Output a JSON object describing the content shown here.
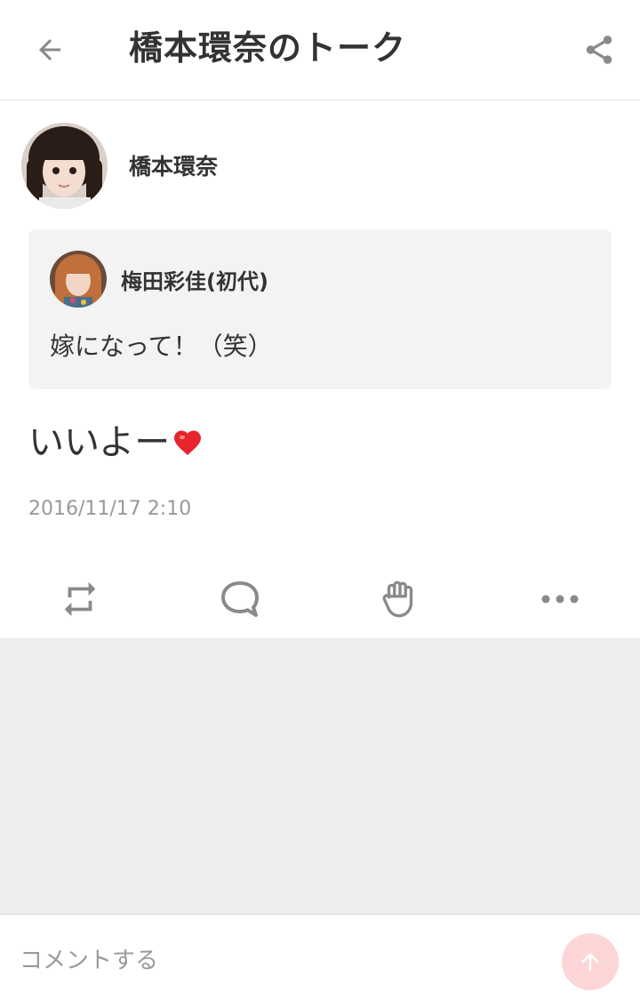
{
  "header": {
    "title": "橋本環奈のトーク",
    "back_icon": "arrow-left-icon",
    "share_icon": "share-icon"
  },
  "post": {
    "author": "橋本環奈",
    "text": "いいよー",
    "emoji": "heart-emoji",
    "timestamp": "2016/11/17 2:10"
  },
  "quoted": {
    "author": "梅田彩佳(初代)",
    "text": "嫁になって！（笑）"
  },
  "actions": [
    {
      "name": "repost-icon"
    },
    {
      "name": "comment-icon"
    },
    {
      "name": "clap-icon"
    },
    {
      "name": "more-icon"
    }
  ],
  "composer": {
    "placeholder": "コメントする",
    "send_icon": "arrow-up-icon"
  },
  "colors": {
    "text": "#333333",
    "muted": "#999999",
    "icon": "#8a8a8a",
    "quote_bg": "#f3f3f3",
    "feed_bg": "#ededed",
    "send_bg": "#fcd6d6",
    "heart": "#e8242c"
  }
}
